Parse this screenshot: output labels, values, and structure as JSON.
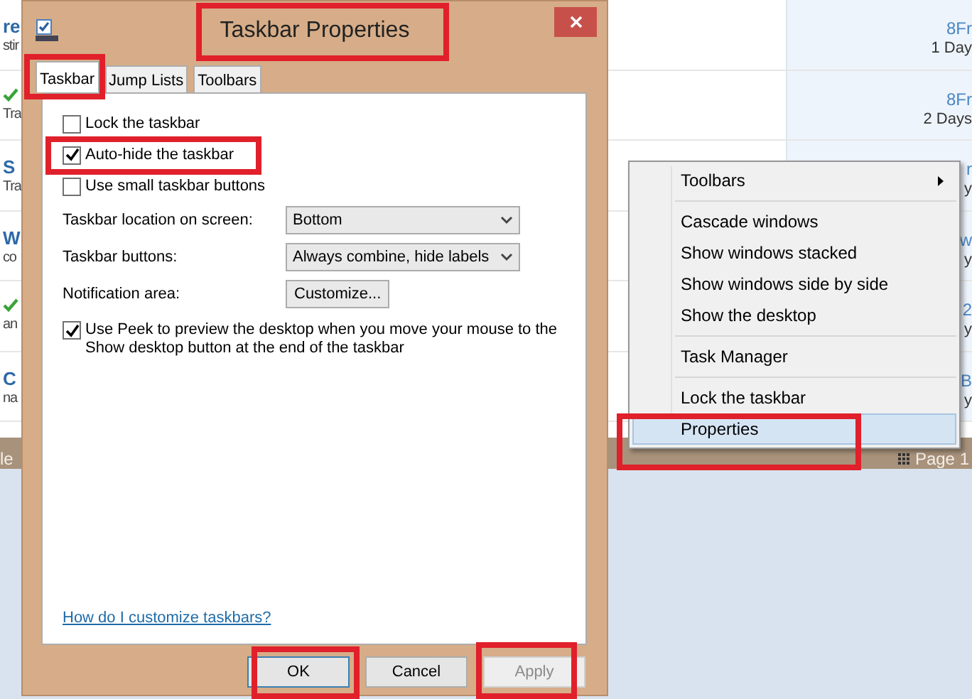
{
  "background_page": {
    "rows": [
      {
        "left_title": "re",
        "left_subtitle": "stir",
        "checked": false,
        "right_title": "8Fr",
        "right_subtitle": "1 Day"
      },
      {
        "left_title": "",
        "left_subtitle": "Tra",
        "checked": true,
        "right_title": "8Fr",
        "right_subtitle": "2 Days"
      },
      {
        "left_title": "S",
        "left_subtitle": "Tra",
        "checked": false,
        "right_title": "r",
        "right_subtitle": "y"
      },
      {
        "left_title": "W",
        "left_subtitle": "co",
        "checked": false,
        "right_title": "w",
        "right_subtitle": "y"
      },
      {
        "left_title": "",
        "left_subtitle": "an",
        "checked": true,
        "right_title": "2",
        "right_subtitle": "y"
      },
      {
        "left_title": "C",
        "left_subtitle": "na",
        "checked": false,
        "right_title": "B",
        "right_subtitle": "y"
      }
    ],
    "taskbar_left_text": "le",
    "taskbar_right_text": "Page 1"
  },
  "window": {
    "title": "Taskbar Properties",
    "tabs": [
      {
        "label": "Taskbar",
        "selected": true
      },
      {
        "label": "Jump Lists",
        "selected": false
      },
      {
        "label": "Toolbars",
        "selected": false
      }
    ],
    "options": [
      {
        "kind": "checkbox",
        "label": "Lock the taskbar",
        "checked": false
      },
      {
        "kind": "checkbox",
        "label": "Auto-hide the taskbar",
        "checked": true
      },
      {
        "kind": "checkbox",
        "label": "Use small taskbar buttons",
        "checked": false
      },
      {
        "kind": "select",
        "label": "Taskbar location on screen:",
        "value": "Bottom"
      },
      {
        "kind": "select",
        "label": "Taskbar buttons:",
        "value": "Always combine, hide labels"
      },
      {
        "kind": "button",
        "label": "Notification area:",
        "value": "Customize..."
      },
      {
        "kind": "checkbox",
        "label": "Use Peek to preview the desktop when you move your mouse to the Show desktop button at the end of the taskbar",
        "checked": true
      }
    ],
    "help_link": "How do I customize taskbars?",
    "buttons": [
      {
        "label": "OK",
        "default": true,
        "disabled": false
      },
      {
        "label": "Cancel",
        "default": false,
        "disabled": false
      },
      {
        "label": "Apply",
        "default": false,
        "disabled": true
      }
    ]
  },
  "context_menu": {
    "items": [
      {
        "kind": "item",
        "label": "Toolbars",
        "submenu": true,
        "selected": false
      },
      {
        "kind": "separator"
      },
      {
        "kind": "item",
        "label": "Cascade windows",
        "submenu": false,
        "selected": false
      },
      {
        "kind": "item",
        "label": "Show windows stacked",
        "submenu": false,
        "selected": false
      },
      {
        "kind": "item",
        "label": "Show windows side by side",
        "submenu": false,
        "selected": false
      },
      {
        "kind": "item",
        "label": "Show the desktop",
        "submenu": false,
        "selected": false
      },
      {
        "kind": "separator"
      },
      {
        "kind": "item",
        "label": "Task Manager",
        "submenu": false,
        "selected": false
      },
      {
        "kind": "separator"
      },
      {
        "kind": "item",
        "label": "Lock the taskbar",
        "submenu": false,
        "selected": false
      },
      {
        "kind": "item",
        "label": "Properties",
        "submenu": false,
        "selected": true
      }
    ]
  }
}
